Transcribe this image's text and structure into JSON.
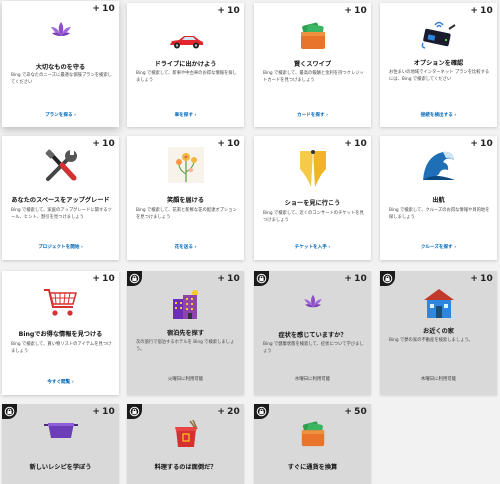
{
  "cards": [
    {
      "points": "10",
      "title": "大切なものを守る",
      "description": "Bing であなたのニーズに最適な保険プランを検索してください",
      "cta": "プランを探る ›",
      "icon": "lotus-icon"
    },
    {
      "points": "10",
      "title": "ドライブに出かけよう",
      "description": "Bing で検索して、新車や中古車のお得な情報を探しましょう",
      "cta": "車を探す ›",
      "icon": "red-car-icon"
    },
    {
      "points": "10",
      "title": "賢くスワイプ",
      "description": "Bing で検索して、最高の報酬と金利を持つクレジットカードを見つけましょう",
      "cta": "カードを探す ›",
      "icon": "wallet-icon"
    },
    {
      "points": "10",
      "title": "オプションを確認",
      "description": "お住まいの地域でインターネット プランを比較するには、Bing で検索してください",
      "cta": "接続を検出する ›",
      "icon": "router-icon"
    },
    {
      "points": "10",
      "title": "あなたのスペースをアップグレード",
      "description": "Bing で検索して、家庭のアップグレードに関するツール、ヒント、割引を見つけましょう",
      "cta": "プロジェクトを開始 ›",
      "icon": "tools-icon"
    },
    {
      "points": "10",
      "title": "笑顔を届ける",
      "description": "Bing で検索して、花束と新鮮な花の配達オプションを見つけましょう",
      "cta": "花を送る ›",
      "icon": "flowers-icon"
    },
    {
      "points": "10",
      "title": "ショーを見に行こう",
      "description": "Bing で検索して、近くのコンサートのチケットを見つけましょう",
      "cta": "チケットを入手 ›",
      "icon": "stage-curtain-icon"
    },
    {
      "points": "10",
      "title": "出航",
      "description": "Bing で検索して、クルーズのお得な情報や目的地を探しましょう",
      "cta": "クルーズを探す ›",
      "icon": "wave-icon"
    },
    {
      "points": "10",
      "title": "Bingでお得な情報を見つける",
      "description": "Bing で検索して、買い物リストのアイテムを見つけましょう",
      "cta": "今すぐ閲覧 ›",
      "icon": "shopping-cart-icon"
    },
    {
      "points": "10",
      "title": "宿泊先を探す",
      "description": "次の旅行で宿泊するホテルを Bing で検索しましょう。",
      "status": "火曜日に利用可能",
      "icon": "hotel-icon",
      "locked": true
    },
    {
      "points": "10",
      "title": "症状を感じていますか？",
      "description": "Bing で健康状態を検索して、症状について学びましょう",
      "status": "水曜日に利用可能",
      "icon": "lotus-icon",
      "locked": true
    },
    {
      "points": "10",
      "title": "お近くの家",
      "description": "Bing で夢の家の不動産を検索しましょう。",
      "status": "木曜日に利用可能",
      "icon": "house-icon",
      "locked": true
    },
    {
      "points": "10",
      "title": "新しいレシピを学ぼう",
      "icon": "pot-icon",
      "locked": true
    },
    {
      "points": "20",
      "title": "料理するのは面倒だ？",
      "icon": "takeout-box-icon",
      "locked": true
    },
    {
      "points": "50",
      "title": "すぐに通貨を換算",
      "icon": "wallet-icon",
      "locked": true
    }
  ]
}
